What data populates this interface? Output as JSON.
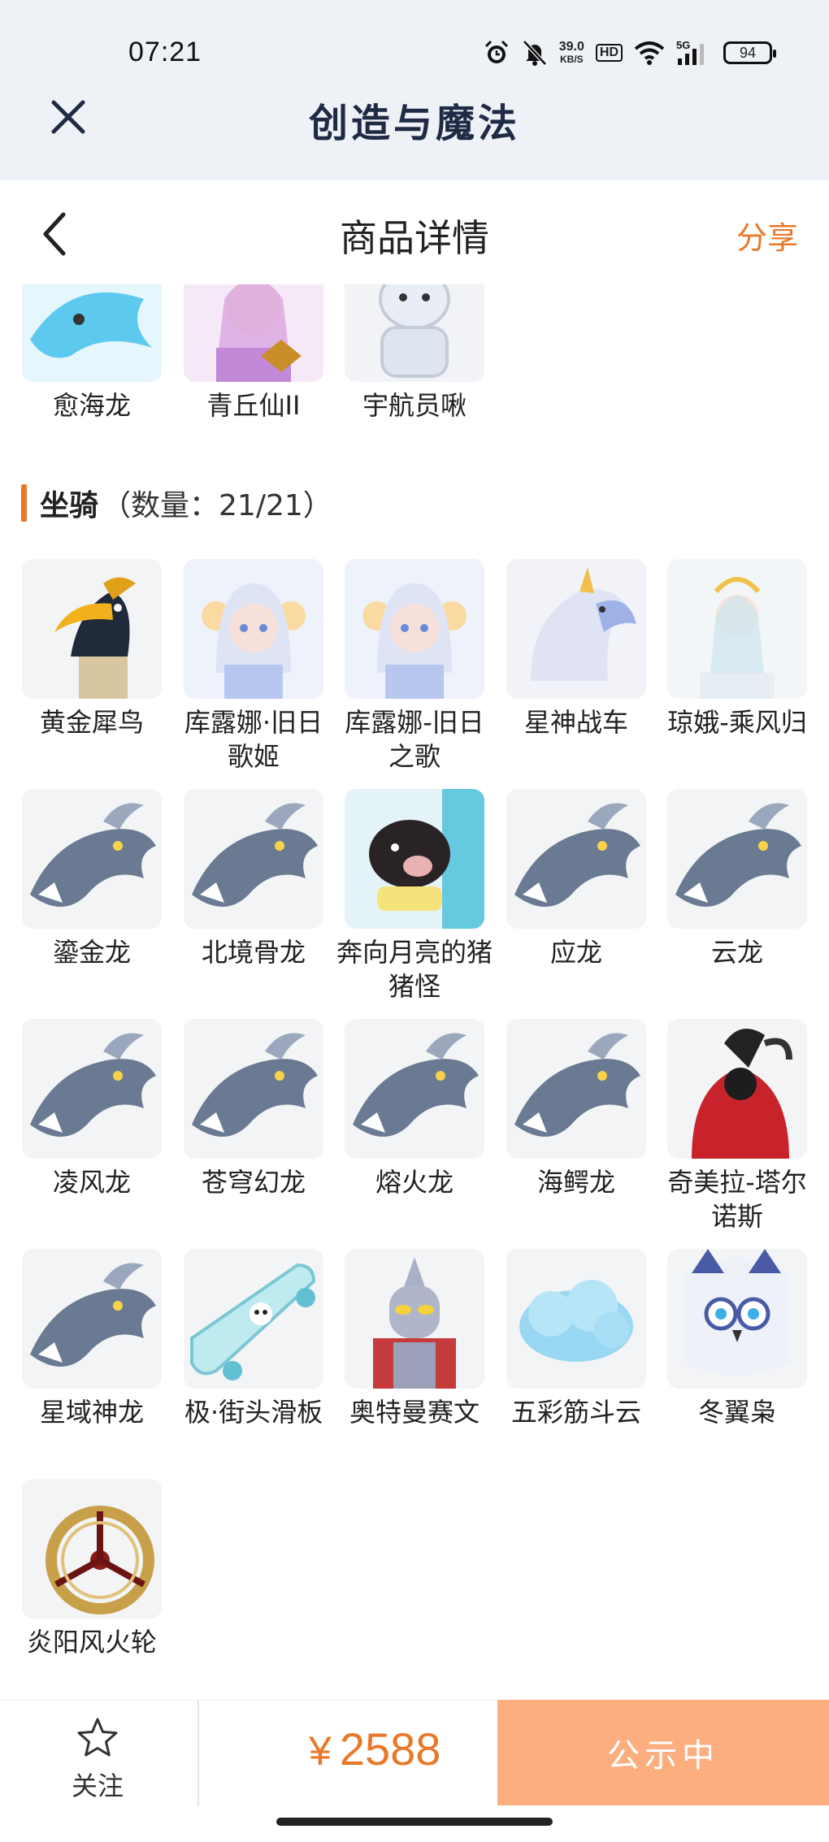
{
  "status_bar": {
    "time": "07:21",
    "net_speed": "39.0",
    "net_unit": "KB/S",
    "hd_label": "HD",
    "network": "5G",
    "battery": "94"
  },
  "app": {
    "title": "创造与魔法"
  },
  "nav": {
    "title": "商品详情",
    "share_label": "分享"
  },
  "top_items": [
    {
      "label": "愈海龙",
      "icon": "dragon-portrait"
    },
    {
      "label": "青丘仙II",
      "icon": "fox-fairy-portrait"
    },
    {
      "label": "宇航员啾",
      "icon": "astronaut-pet-portrait"
    }
  ],
  "mounts_section": {
    "title": "坐骑",
    "count_text": "（数量：21/21）"
  },
  "mounts": [
    {
      "label": "黄金犀鸟",
      "icon": "hornbill-mount"
    },
    {
      "label": "库露娜·旧日歌姬",
      "icon": "singer-mount"
    },
    {
      "label": "库露娜-旧日之歌",
      "icon": "singer-mount"
    },
    {
      "label": "星神战车",
      "icon": "chariot-mount"
    },
    {
      "label": "琼娥-乘风归",
      "icon": "fairy-mount"
    },
    {
      "label": "鎏金龙",
      "icon": "dragon-mount"
    },
    {
      "label": "北境骨龙",
      "icon": "dragon-mount"
    },
    {
      "label": "奔向月亮的猪猪怪",
      "icon": "pig-mount"
    },
    {
      "label": "应龙",
      "icon": "dragon-mount"
    },
    {
      "label": "云龙",
      "icon": "dragon-mount"
    },
    {
      "label": "凌风龙",
      "icon": "dragon-mount"
    },
    {
      "label": "苍穹幻龙",
      "icon": "dragon-mount"
    },
    {
      "label": "熔火龙",
      "icon": "dragon-mount"
    },
    {
      "label": "海鳄龙",
      "icon": "dragon-mount"
    },
    {
      "label": "奇美拉-塔尔诺斯",
      "icon": "chimera-mount"
    },
    {
      "label": "星域神龙",
      "icon": "dragon-mount"
    },
    {
      "label": "极·街头滑板",
      "icon": "skateboard-mount"
    },
    {
      "label": "奥特曼赛文",
      "icon": "hero-mount"
    },
    {
      "label": "五彩筋斗云",
      "icon": "cloud-mount"
    },
    {
      "label": "冬翼枭",
      "icon": "owl-mount"
    },
    {
      "label": "炎阳风火轮",
      "icon": "wheel-mount"
    }
  ],
  "bottom_bar": {
    "follow_label": "关注",
    "price_symbol": "¥",
    "price": "2588",
    "cta_label": "公示中"
  },
  "colors": {
    "accent": "#e8782a",
    "cta_bg": "#fdae7f",
    "header_bg": "#eef2f6",
    "app_title": "#1f2a44"
  }
}
